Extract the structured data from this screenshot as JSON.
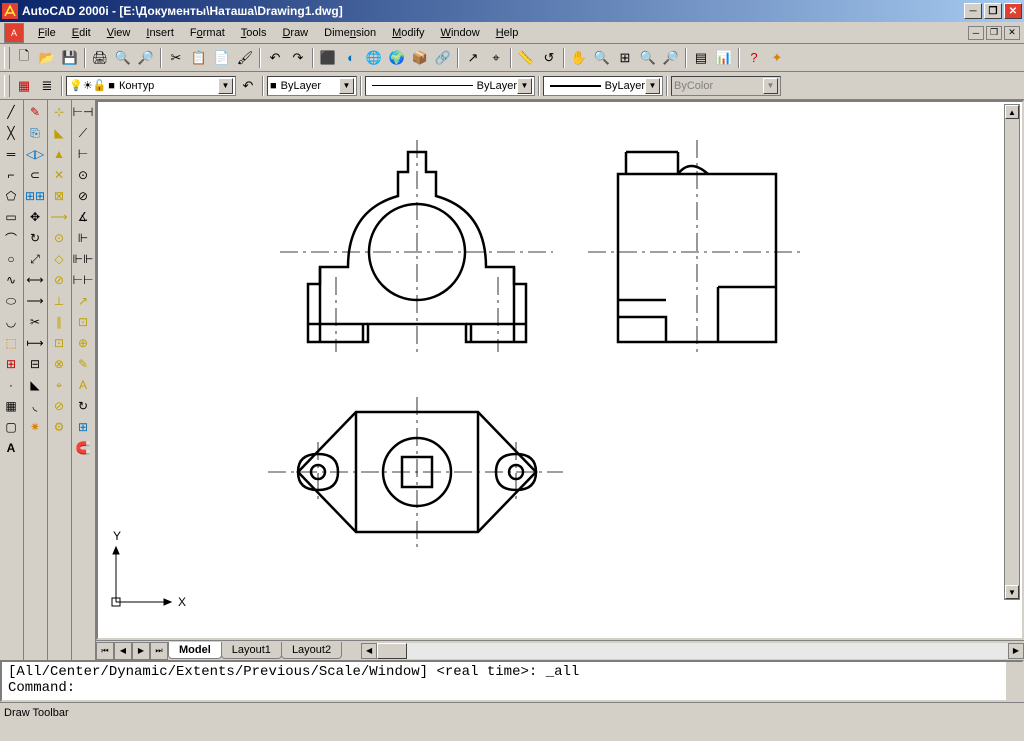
{
  "title": "AutoCAD 2000i - [E:\\Документы\\Наташа\\Drawing1.dwg]",
  "menu": {
    "file": "File",
    "edit": "Edit",
    "view": "View",
    "insert": "Insert",
    "format": "Format",
    "tools": "Tools",
    "draw": "Draw",
    "dimension": "Dimension",
    "modify": "Modify",
    "window": "Window",
    "help": "Help"
  },
  "layers": {
    "current": "Контур",
    "linetype": "ByLayer",
    "lineweight": "ByLayer",
    "linestyle": "ByLayer",
    "color": "ByColor"
  },
  "tabs": {
    "model": "Model",
    "layout1": "Layout1",
    "layout2": "Layout2"
  },
  "command": {
    "line1": "[All/Center/Dynamic/Extents/Previous/Scale/Window] <real time>: _all",
    "line2": "Command:"
  },
  "status": "Draw Toolbar",
  "ucs": {
    "x": "X",
    "y": "Y"
  }
}
